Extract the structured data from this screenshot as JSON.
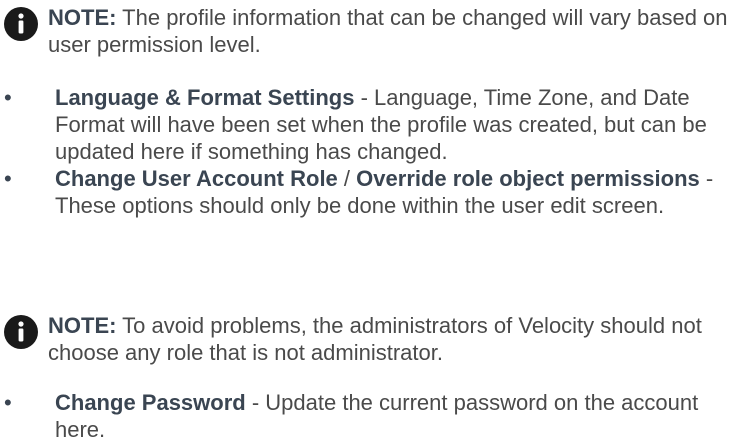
{
  "notes": [
    {
      "label": "NOTE:",
      "text": "The profile information that can be changed will vary based on user permission level."
    },
    {
      "label": "NOTE:",
      "text": "To avoid problems, the administrators of Velocity should not choose any role that is not administrator."
    }
  ],
  "bullets_a": [
    {
      "title": "Language & Format Settings",
      "text": "- Language, Time Zone, and Date Format will have been set when the profile was created, but can be updated here if something has changed."
    },
    {
      "title": "Change User Account Role",
      "separator": "/",
      "title2": "Override role object permissions",
      "text": "- These options should only be done within the user edit screen."
    }
  ],
  "bullets_b": [
    {
      "title": "Change Password",
      "text": "- Update the current password on the account here."
    }
  ],
  "bullet_symbol": "•",
  "icon": "info-icon",
  "colors": {
    "body_text": "#4a4a4a",
    "heading_text": "#3a4552",
    "icon_fill": "#1a1a1a"
  }
}
